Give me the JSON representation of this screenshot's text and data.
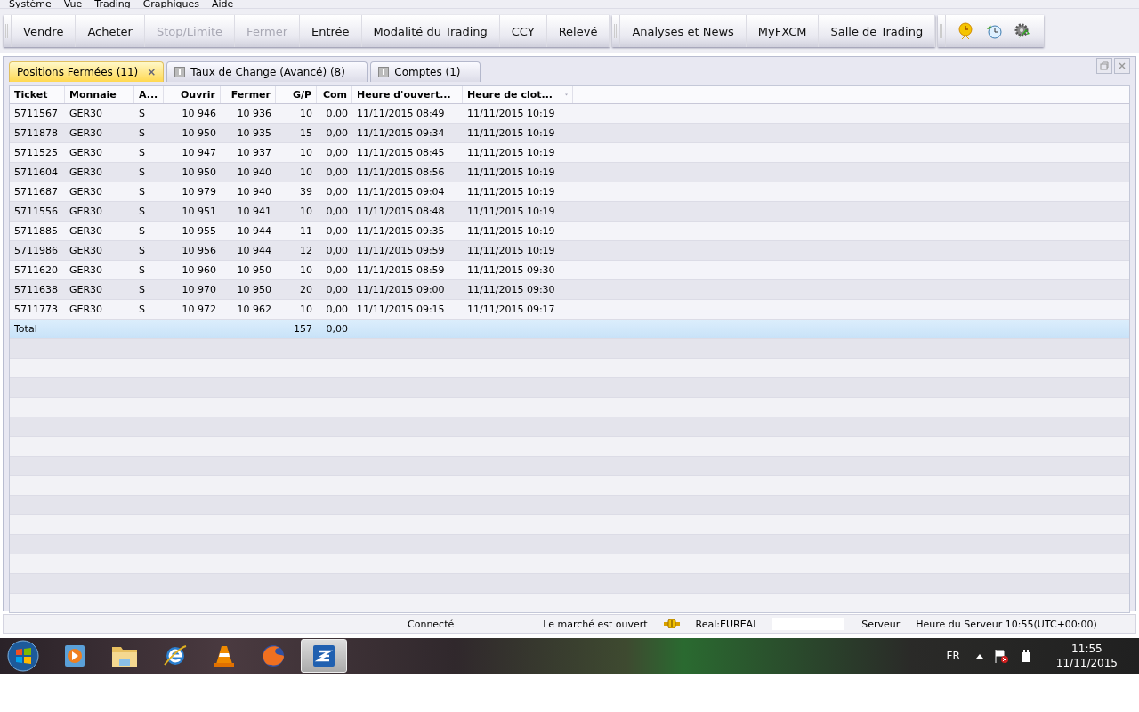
{
  "menu": [
    "Système",
    "Vue",
    "Trading",
    "Graphiques",
    "Aide"
  ],
  "toolbar_groups": [
    [
      {
        "label": "Vendre",
        "disabled": false
      },
      {
        "label": "Acheter",
        "disabled": false
      },
      {
        "label": "Stop/Limite",
        "disabled": true
      },
      {
        "label": "Fermer",
        "disabled": true
      },
      {
        "label": "Entrée",
        "disabled": false
      },
      {
        "label": "Modalité du Trading",
        "disabled": false
      },
      {
        "label": "CCY",
        "disabled": false
      },
      {
        "label": "Relevé",
        "disabled": false
      }
    ],
    [
      {
        "label": "Analyses et News",
        "disabled": false
      },
      {
        "label": "MyFXCM",
        "disabled": false
      },
      {
        "label": "Salle de Trading",
        "disabled": false
      }
    ]
  ],
  "tabs": [
    {
      "label": "Positions Fermées (11)",
      "selected": true,
      "close": "×"
    },
    {
      "label": "Taux de Change (Avancé) (8)",
      "selected": false
    },
    {
      "label": "Comptes (1)",
      "selected": false
    }
  ],
  "table": {
    "columns": [
      {
        "label": "Ticket"
      },
      {
        "label": "Monnaie"
      },
      {
        "label": "A..."
      },
      {
        "label": "Ouvrir"
      },
      {
        "label": "Fermer"
      },
      {
        "label": "G/P"
      },
      {
        "label": "Com"
      },
      {
        "label": "Heure d'ouvert..."
      },
      {
        "label": "Heure de clot...",
        "sorted": true
      }
    ],
    "rows": [
      [
        "5711567",
        "GER30",
        "S",
        "10 946",
        "10 936",
        "10",
        "0,00",
        "11/11/2015 08:49",
        "11/11/2015 10:19"
      ],
      [
        "5711878",
        "GER30",
        "S",
        "10 950",
        "10 935",
        "15",
        "0,00",
        "11/11/2015 09:34",
        "11/11/2015 10:19"
      ],
      [
        "5711525",
        "GER30",
        "S",
        "10 947",
        "10 937",
        "10",
        "0,00",
        "11/11/2015 08:45",
        "11/11/2015 10:19"
      ],
      [
        "5711604",
        "GER30",
        "S",
        "10 950",
        "10 940",
        "10",
        "0,00",
        "11/11/2015 08:56",
        "11/11/2015 10:19"
      ],
      [
        "5711687",
        "GER30",
        "S",
        "10 979",
        "10 940",
        "39",
        "0,00",
        "11/11/2015 09:04",
        "11/11/2015 10:19"
      ],
      [
        "5711556",
        "GER30",
        "S",
        "10 951",
        "10 941",
        "10",
        "0,00",
        "11/11/2015 08:48",
        "11/11/2015 10:19"
      ],
      [
        "5711885",
        "GER30",
        "S",
        "10 955",
        "10 944",
        "11",
        "0,00",
        "11/11/2015 09:35",
        "11/11/2015 10:19"
      ],
      [
        "5711986",
        "GER30",
        "S",
        "10 956",
        "10 944",
        "12",
        "0,00",
        "11/11/2015 09:59",
        "11/11/2015 10:19"
      ],
      [
        "5711620",
        "GER30",
        "S",
        "10 960",
        "10 950",
        "10",
        "0,00",
        "11/11/2015 08:59",
        "11/11/2015 09:30"
      ],
      [
        "5711638",
        "GER30",
        "S",
        "10 970",
        "10 950",
        "20",
        "0,00",
        "11/11/2015 09:00",
        "11/11/2015 09:30"
      ],
      [
        "5711773",
        "GER30",
        "S",
        "10 972",
        "10 962",
        "10",
        "0,00",
        "11/11/2015 09:15",
        "11/11/2015 09:17"
      ]
    ],
    "total": {
      "label": "Total",
      "gp": "157",
      "com": "0,00"
    }
  },
  "status_bar": {
    "connection": "Connecté",
    "market": "Le marché est ouvert",
    "account": "Real:EUREAL",
    "server": "Serveur",
    "server_time": "Heure du Serveur 10:55(UTC+00:00)"
  },
  "taskbar": {
    "language": "FR",
    "time": "11:55",
    "date": "11/11/2015"
  }
}
